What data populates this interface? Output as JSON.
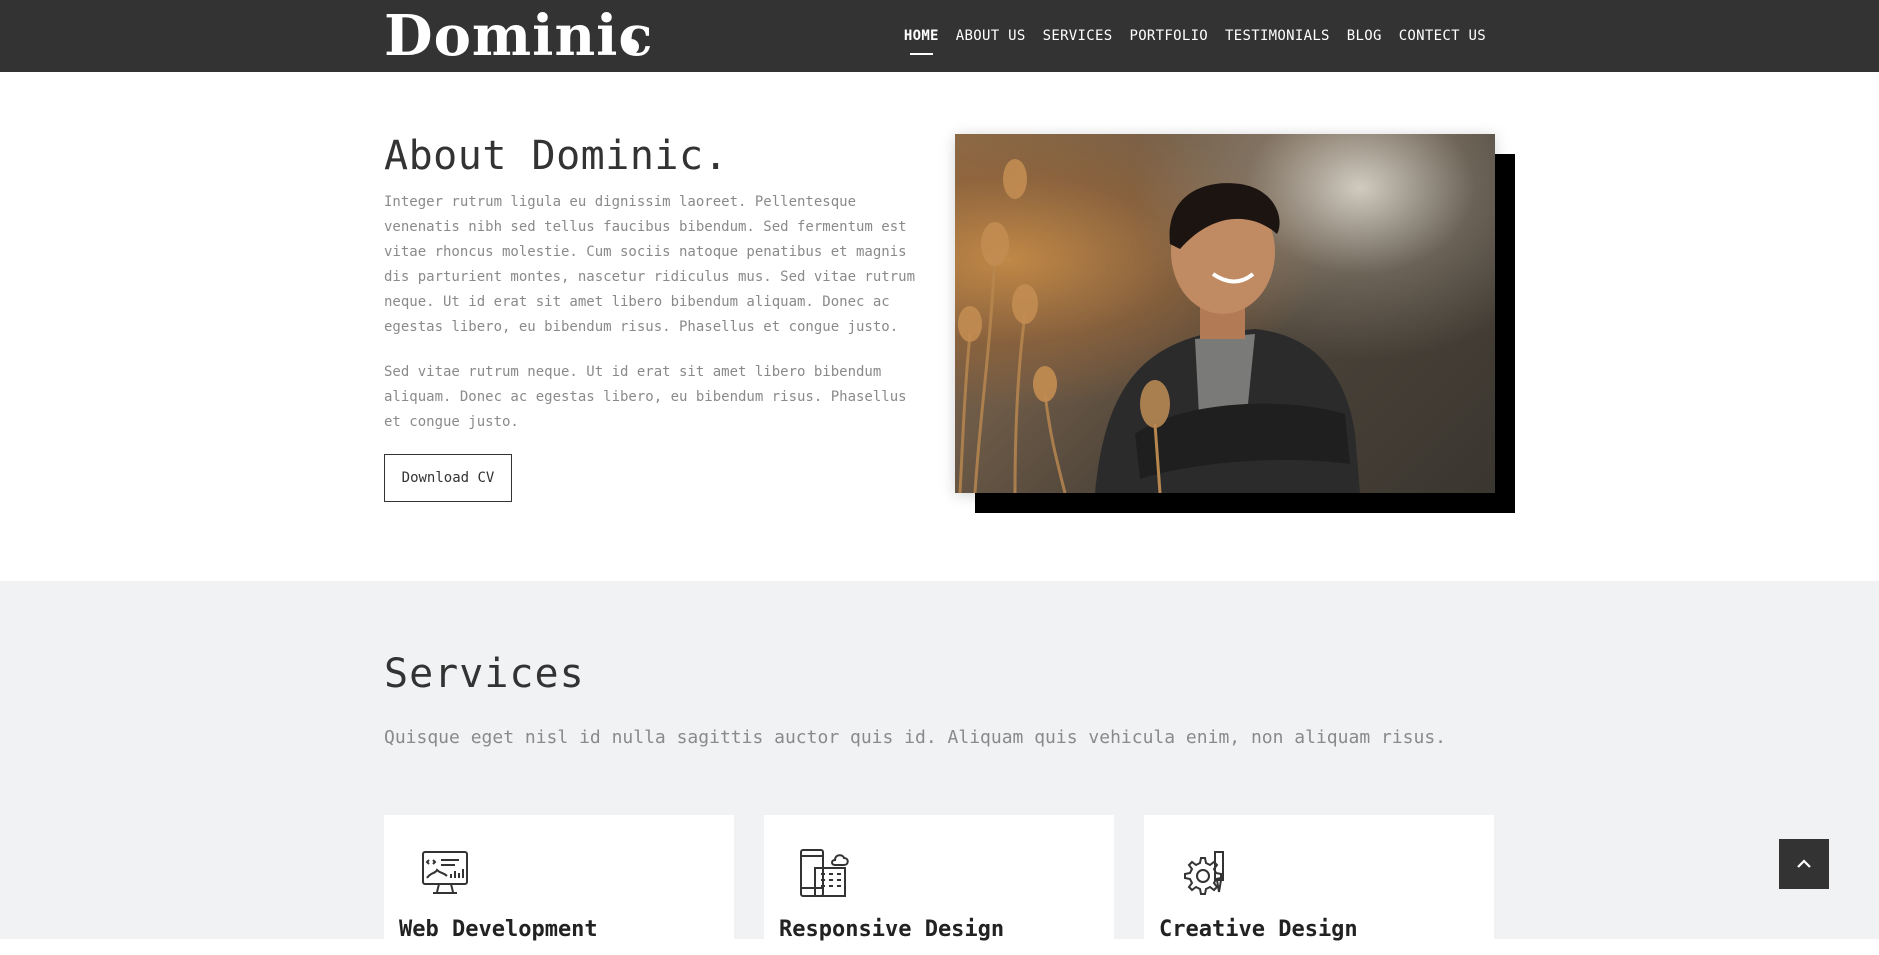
{
  "header": {
    "logo": "Dominic",
    "nav": [
      "HOME",
      "ABOUT US",
      "SERVICES",
      "PORTFOLIO",
      "TESTIMONIALS",
      "BLOG",
      "CONTECT US"
    ],
    "active_item": "HOME"
  },
  "about": {
    "title": "About Dominic.",
    "paragraph1": "Integer rutrum ligula eu dignissim laoreet. Pellentesque venenatis nibh sed tellus faucibus bibendum. Sed fermentum est vitae rhoncus molestie. Cum sociis natoque penatibus et magnis dis parturient montes, nascetur ridiculus mus. Sed vitae rutrum neque. Ut id erat sit amet libero bibendum aliquam. Donec ac egestas libero, eu bibendum risus. Phasellus et congue justo.",
    "paragraph2": "Sed vitae rutrum neque. Ut id erat sit amet libero bibendum aliquam. Donec ac egestas libero, eu bibendum risus. Phasellus et congue justo.",
    "button": "Download CV"
  },
  "services": {
    "title": "Services",
    "subtitle": "Quisque eget nisl id nulla sagittis auctor quis id. Aliquam quis vehicula enim, non aliquam risus.",
    "cards": [
      {
        "title": "Web Development",
        "icon": "monitor-code-icon"
      },
      {
        "title": "Responsive Design",
        "icon": "devices-building-icon"
      },
      {
        "title": "Creative Design",
        "icon": "gear-tools-icon"
      }
    ]
  },
  "colors": {
    "header_bg": "#333333",
    "services_bg": "#f1f2f4",
    "text_muted": "#8a8a8a",
    "text_dark": "#333333"
  },
  "back_to_top_icon": "chevron-up-icon"
}
